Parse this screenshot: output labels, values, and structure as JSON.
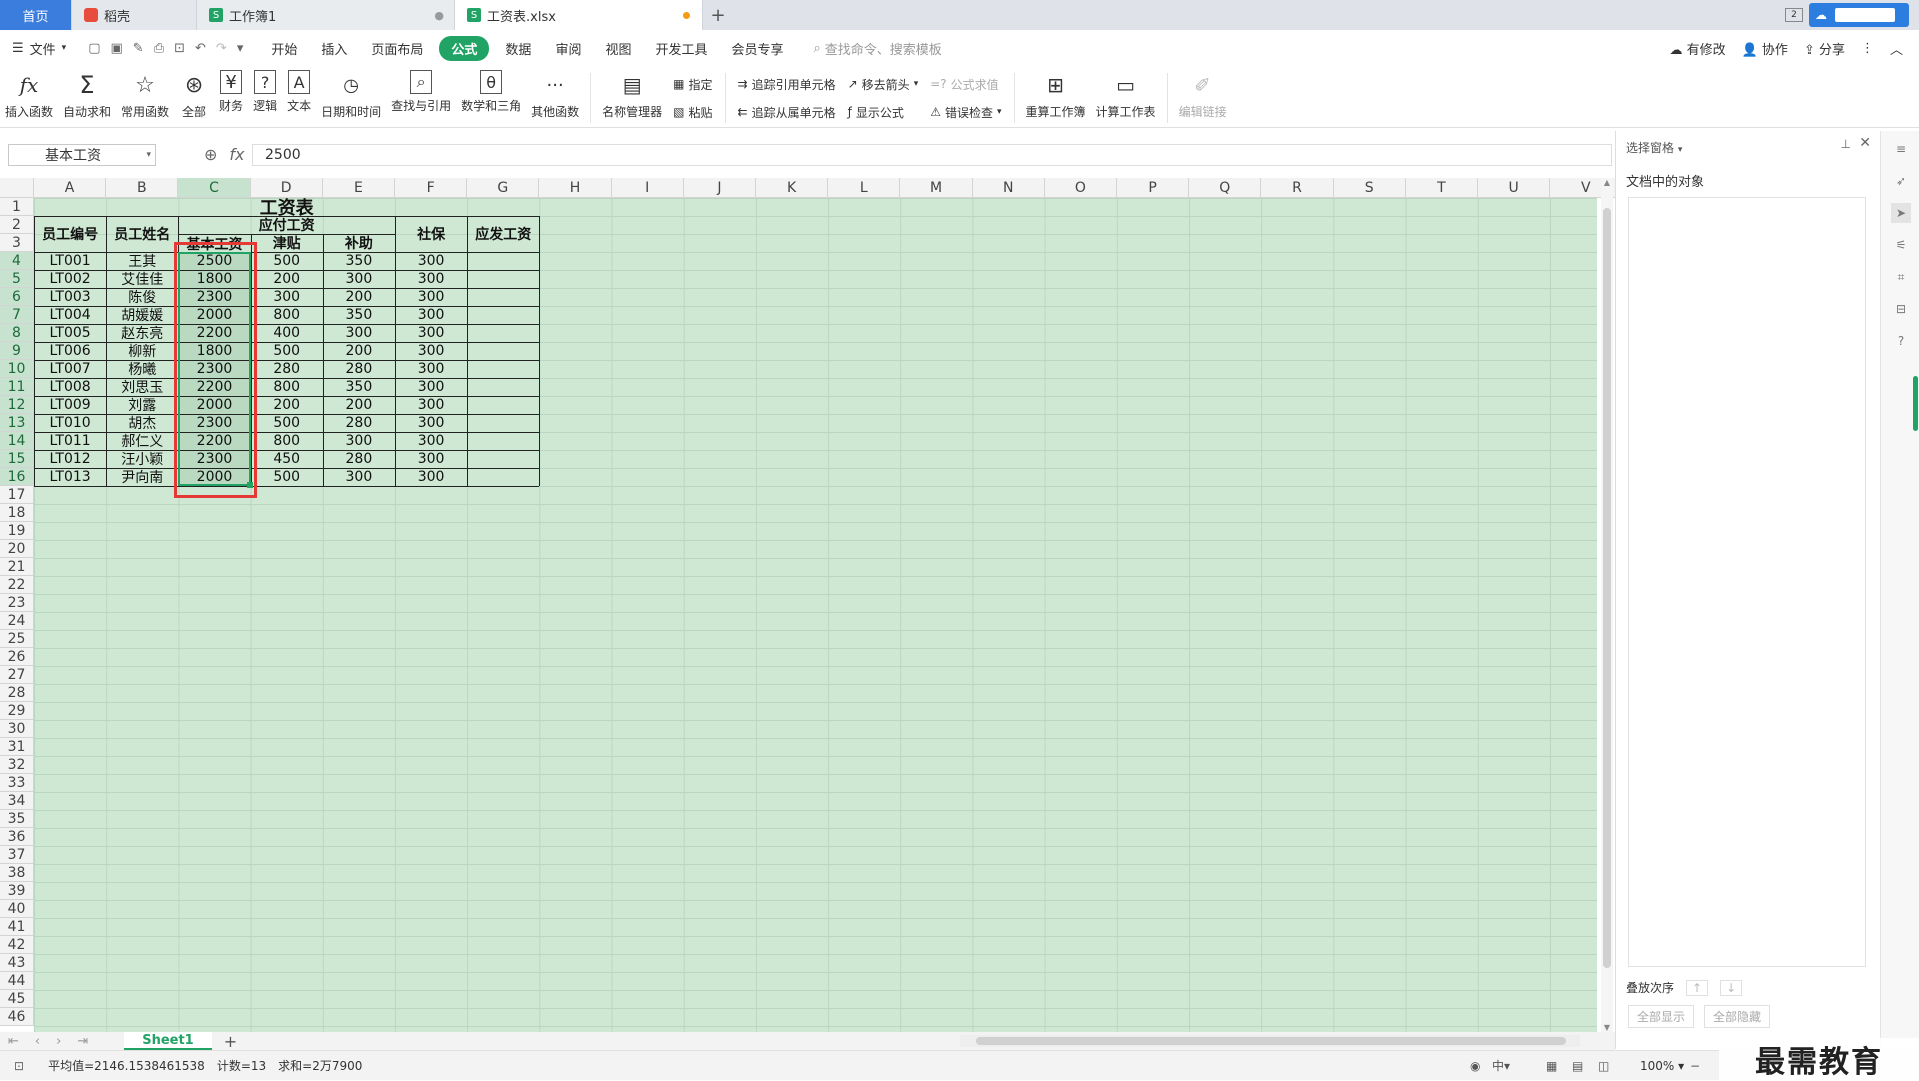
{
  "tabs": {
    "home": "首页",
    "docer": "稻壳",
    "book1": "工作簿1",
    "file": "工资表.xlsx",
    "new_tab": "+"
  },
  "menu": {
    "file": "文件",
    "items": [
      "开始",
      "插入",
      "页面布局",
      "公式",
      "数据",
      "审阅",
      "视图",
      "开发工具",
      "会员专享"
    ],
    "active": "公式",
    "search_placeholder": "查找命令、搜索模板",
    "modified": "有修改",
    "collab": "协作",
    "share": "分享"
  },
  "ribbon": {
    "insert_fn": "插入函数",
    "autosum": "自动求和",
    "common": "常用函数",
    "all": "全部",
    "finance": "财务",
    "logic": "逻辑",
    "text": "文本",
    "datetime": "日期和时间",
    "lookup": "查找与引用",
    "math": "数学和三角",
    "other": "其他函数",
    "name_mgr": "名称管理器",
    "specify": "指定",
    "paste": "粘贴",
    "trace_prec": "追踪引用单元格",
    "trace_dep": "追踪从属单元格",
    "remove_arrows": "移去箭头",
    "show_formula": "显示公式",
    "formula_eval": "公式求值",
    "error_check": "错误检查",
    "recalc_book": "重算工作簿",
    "calc_sheet": "计算工作表",
    "edit_links": "编辑链接"
  },
  "formula": {
    "name_box": "基本工资",
    "fx": "fx",
    "value": "2500"
  },
  "columns": [
    "A",
    "B",
    "C",
    "D",
    "E",
    "F",
    "G",
    "H",
    "I",
    "J",
    "K",
    "L",
    "M",
    "N",
    "O",
    "P",
    "Q",
    "R",
    "S",
    "T",
    "U",
    "V"
  ],
  "rows": [
    "1",
    "2",
    "3",
    "4",
    "5",
    "6",
    "7",
    "8",
    "9",
    "10",
    "11",
    "12",
    "13",
    "14",
    "15",
    "16",
    "17",
    "18",
    "19",
    "20",
    "21",
    "22",
    "23",
    "24",
    "25",
    "26",
    "27",
    "28",
    "29",
    "30",
    "31",
    "32",
    "33",
    "34",
    "35",
    "36",
    "37",
    "38",
    "39",
    "40",
    "41",
    "42",
    "43",
    "44",
    "45",
    "46"
  ],
  "table": {
    "title": "工资表",
    "h_id": "员工编号",
    "h_name": "员工姓名",
    "h_pay": "应付工资",
    "h_base": "基本工资",
    "h_allow": "津贴",
    "h_subsidy": "补助",
    "h_social": "社保",
    "h_actual": "应发工资",
    "rows": [
      [
        "LT001",
        "王其",
        "2500",
        "500",
        "350",
        "300"
      ],
      [
        "LT002",
        "艾佳佳",
        "1800",
        "200",
        "300",
        "300"
      ],
      [
        "LT003",
        "陈俊",
        "2300",
        "300",
        "200",
        "300"
      ],
      [
        "LT004",
        "胡媛媛",
        "2000",
        "800",
        "350",
        "300"
      ],
      [
        "LT005",
        "赵东亮",
        "2200",
        "400",
        "300",
        "300"
      ],
      [
        "LT006",
        "柳新",
        "1800",
        "500",
        "200",
        "300"
      ],
      [
        "LT007",
        "杨曦",
        "2300",
        "280",
        "280",
        "300"
      ],
      [
        "LT008",
        "刘思玉",
        "2200",
        "800",
        "350",
        "300"
      ],
      [
        "LT009",
        "刘露",
        "2000",
        "200",
        "200",
        "300"
      ],
      [
        "LT010",
        "胡杰",
        "2300",
        "500",
        "280",
        "300"
      ],
      [
        "LT011",
        "郝仁义",
        "2200",
        "800",
        "300",
        "300"
      ],
      [
        "LT012",
        "汪小颖",
        "2300",
        "450",
        "280",
        "300"
      ],
      [
        "LT013",
        "尹向南",
        "2000",
        "500",
        "300",
        "300"
      ]
    ]
  },
  "panel": {
    "title": "选择窗格",
    "objects": "文档中的对象",
    "order": "叠放次序",
    "show_all": "全部显示",
    "hide_all": "全部隐藏"
  },
  "sheet": {
    "name": "Sheet1"
  },
  "status": {
    "avg": "平均值=2146.1538461538",
    "count": "计数=13",
    "sum": "求和=2万7900",
    "zoom": "100%",
    "ime": "中"
  },
  "watermark": "最需教育",
  "colors": {
    "accent": "#21a366",
    "grid_bg": "#cfe8d3",
    "selection": "#e53935"
  }
}
